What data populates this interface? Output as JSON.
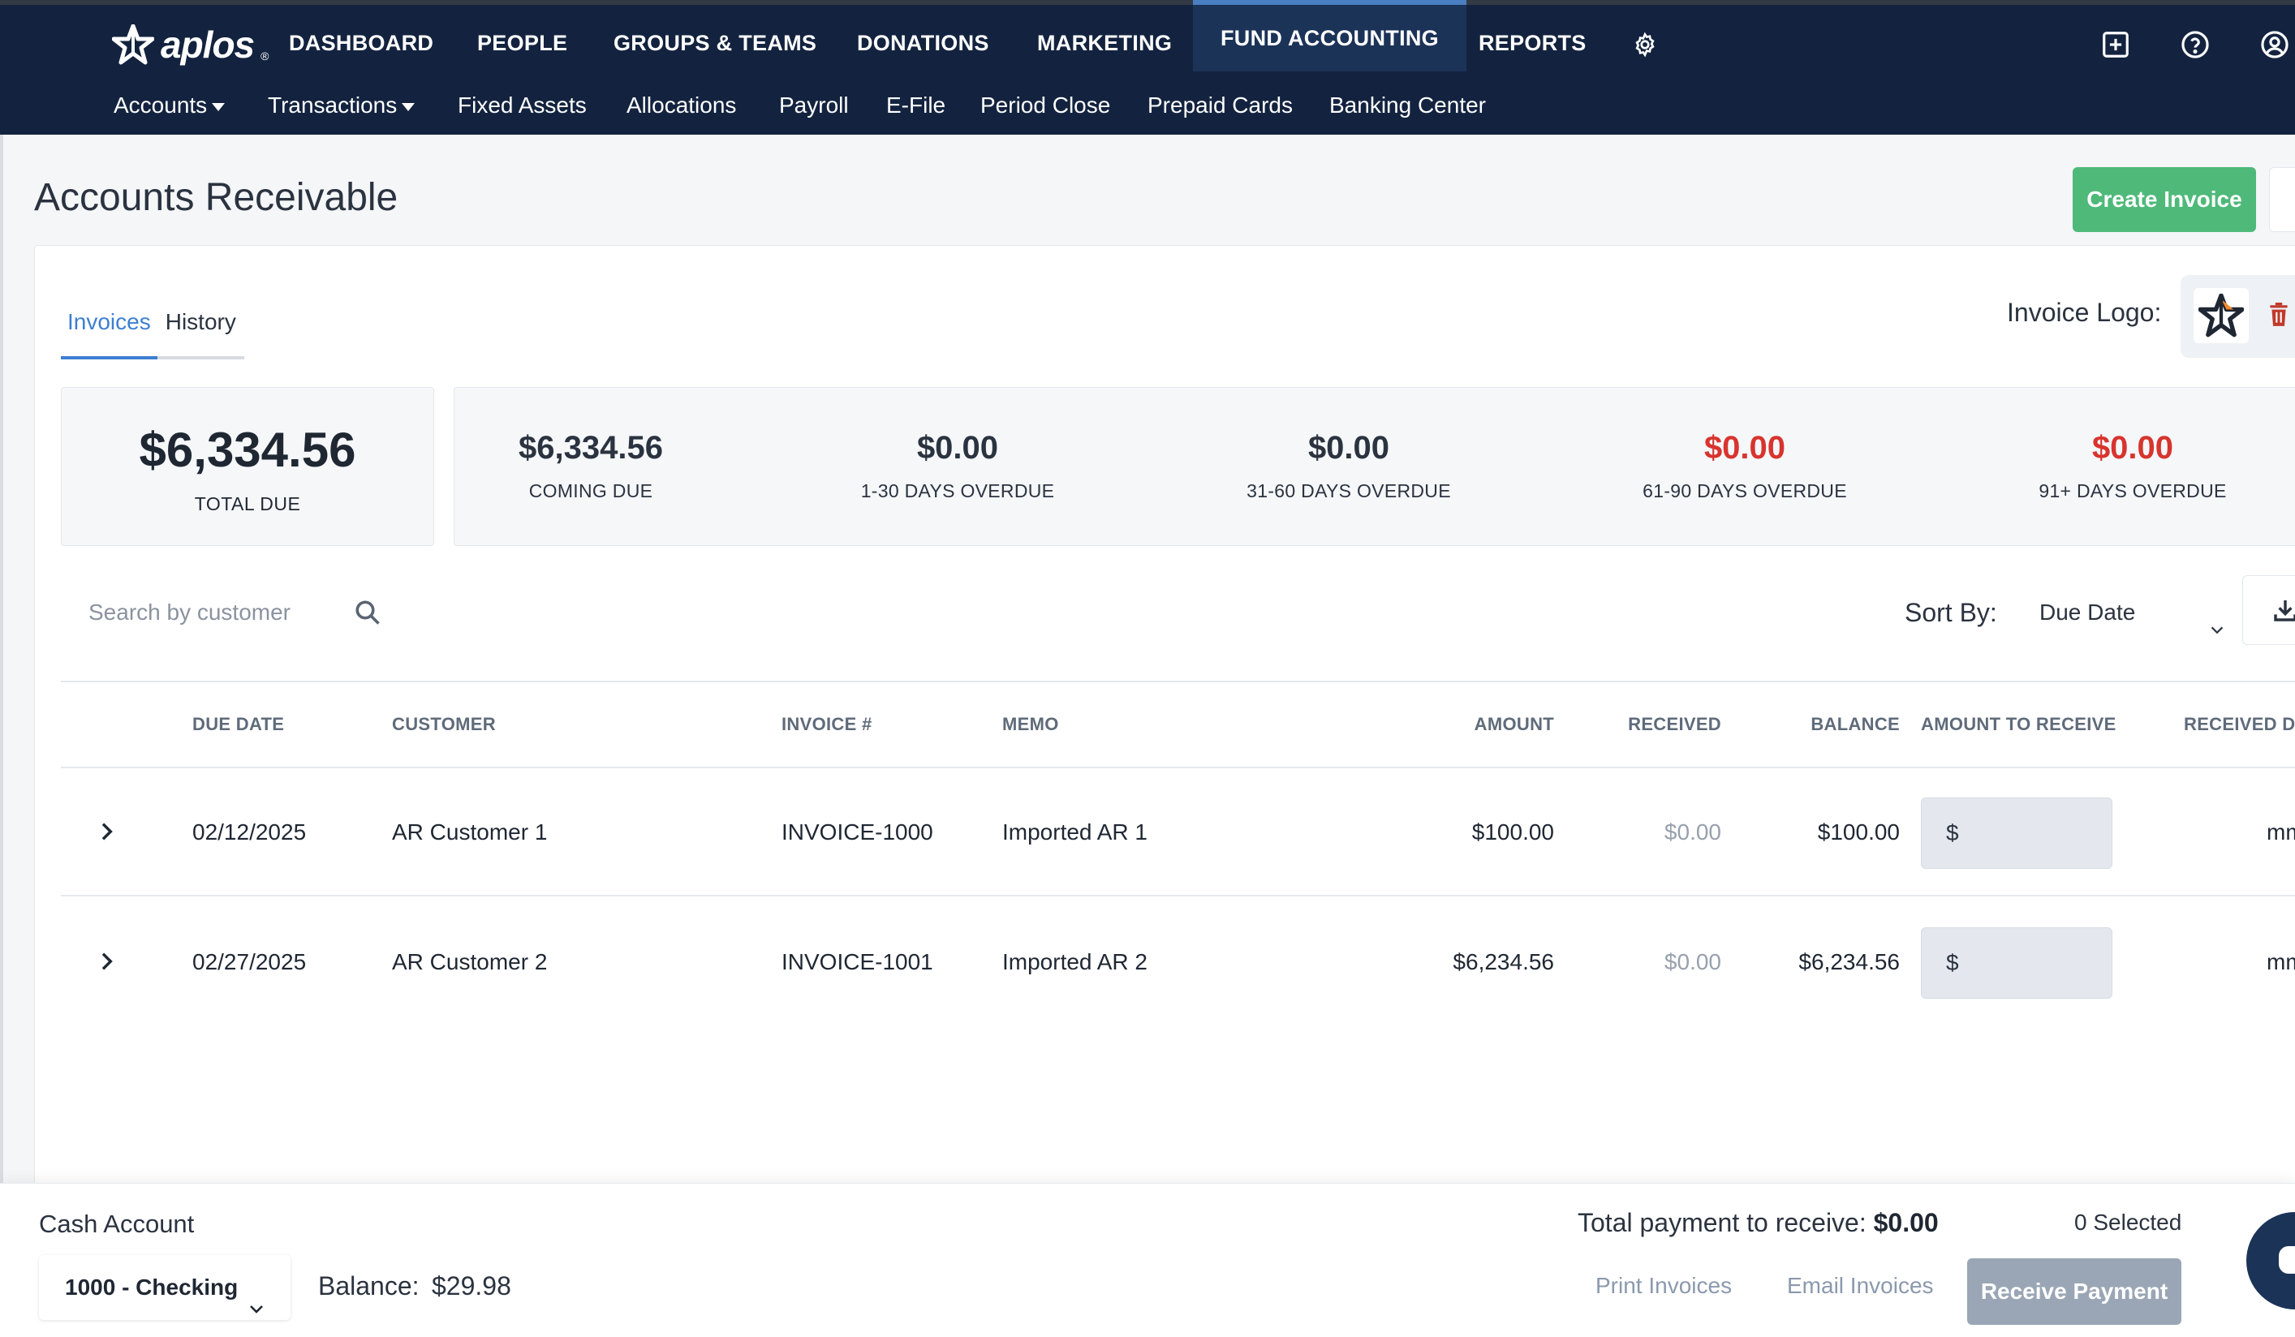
{
  "app": {
    "logo_text": "aplos",
    "logo_reg": "®"
  },
  "nav": {
    "main": [
      {
        "label": "DASHBOARD"
      },
      {
        "label": "PEOPLE"
      },
      {
        "label": "GROUPS & TEAMS"
      },
      {
        "label": "DONATIONS"
      },
      {
        "label": "MARKETING"
      },
      {
        "label": "FUND ACCOUNTING",
        "active": true
      },
      {
        "label": "REPORTS"
      }
    ],
    "icons": [
      "settings-gear-icon",
      "add-box-icon",
      "help-circle-icon",
      "user-account-icon"
    ],
    "sub": [
      {
        "label": "Accounts",
        "dropdown": true
      },
      {
        "label": "Transactions",
        "dropdown": true
      },
      {
        "label": "Fixed Assets"
      },
      {
        "label": "Allocations"
      },
      {
        "label": "Payroll"
      },
      {
        "label": "E-File"
      },
      {
        "label": "Period Close"
      },
      {
        "label": "Prepaid Cards"
      },
      {
        "label": "Banking Center"
      }
    ]
  },
  "page": {
    "title": "Accounts Receivable",
    "create_button": "Create Invoice"
  },
  "tabs": [
    {
      "label": "Invoices",
      "active": true
    },
    {
      "label": "History"
    }
  ],
  "invoice_logo": {
    "label": "Invoice Logo:"
  },
  "summary": {
    "total": {
      "value": "$6,334.56",
      "label": "TOTAL DUE"
    },
    "aging": [
      {
        "value": "$6,334.56",
        "label": "COMING DUE",
        "red": false
      },
      {
        "value": "$0.00",
        "label": "1-30 DAYS OVERDUE",
        "red": false
      },
      {
        "value": "$0.00",
        "label": "31-60 DAYS OVERDUE",
        "red": false
      },
      {
        "value": "$0.00",
        "label": "61-90 DAYS OVERDUE",
        "red": true
      },
      {
        "value": "$0.00",
        "label": "91+ DAYS OVERDUE",
        "red": true
      }
    ]
  },
  "filters": {
    "search_placeholder": "Search by customer",
    "sort_label": "Sort By:",
    "sort_value": "Due Date"
  },
  "table": {
    "headers": {
      "due_date": "DUE DATE",
      "customer": "CUSTOMER",
      "invoice": "INVOICE #",
      "memo": "MEMO",
      "amount": "AMOUNT",
      "received": "RECEIVED",
      "balance": "BALANCE",
      "amount_to_receive": "AMOUNT TO RECEIVE",
      "received_date": "RECEIVED DA"
    },
    "rows": [
      {
        "due_date": "02/12/2025",
        "customer": "AR Customer 1",
        "invoice": "INVOICE-1000",
        "memo": "Imported AR 1",
        "amount": "$100.00",
        "received": "$0.00",
        "balance": "$100.00",
        "amount_placeholder": "$",
        "date_placeholder": "mm/"
      },
      {
        "due_date": "02/27/2025",
        "customer": "AR Customer 2",
        "invoice": "INVOICE-1001",
        "memo": "Imported AR 2",
        "amount": "$6,234.56",
        "received": "$0.00",
        "balance": "$6,234.56",
        "amount_placeholder": "$",
        "date_placeholder": "mm/"
      }
    ]
  },
  "footer": {
    "cash_account_label": "Cash Account",
    "cash_account_value": "1000 - Checking",
    "balance_label": "Balance:",
    "balance_value": "$29.98",
    "total_payment_label": "Total payment to receive:",
    "total_payment_value": "$0.00",
    "selected_text": "0 Selected",
    "print_button": "Print Invoices",
    "email_button": "Email Invoices",
    "receive_button": "Receive Payment"
  },
  "colors": {
    "nav_bg": "#13233f",
    "accent_blue": "#3d7fd1",
    "create_green": "#4fb97a",
    "overdue_red": "#d8342e",
    "disabled_gray": "#9aa6b5"
  }
}
